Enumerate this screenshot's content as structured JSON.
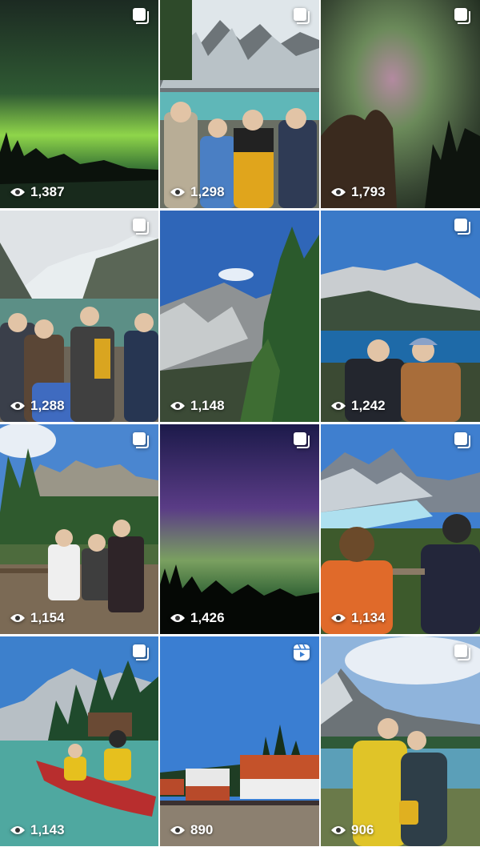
{
  "posts": [
    {
      "views": "1,387",
      "type": "carousel",
      "icon": "carousel-icon"
    },
    {
      "views": "1,298",
      "type": "carousel",
      "icon": "carousel-icon"
    },
    {
      "views": "1,793",
      "type": "carousel",
      "icon": "carousel-icon"
    },
    {
      "views": "1,288",
      "type": "carousel",
      "icon": "carousel-icon"
    },
    {
      "views": "1,148",
      "type": "single",
      "icon": ""
    },
    {
      "views": "1,242",
      "type": "carousel",
      "icon": "carousel-icon"
    },
    {
      "views": "1,154",
      "type": "carousel",
      "icon": "carousel-icon"
    },
    {
      "views": "1,426",
      "type": "carousel",
      "icon": "carousel-icon"
    },
    {
      "views": "1,134",
      "type": "carousel",
      "icon": "carousel-icon"
    },
    {
      "views": "1,143",
      "type": "carousel",
      "icon": "carousel-icon"
    },
    {
      "views": "890",
      "type": "reel",
      "icon": "reel-icon"
    },
    {
      "views": "906",
      "type": "carousel",
      "icon": "carousel-icon"
    }
  ],
  "overlay_text_color": "#ffffff"
}
